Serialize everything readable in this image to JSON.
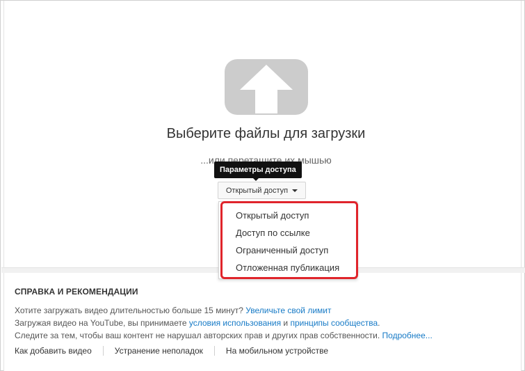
{
  "upload": {
    "title": "Выберите файлы для загрузки",
    "subtitle": "...или перетащите их мышью",
    "icon": "upload-arrow-icon"
  },
  "privacy": {
    "tooltip": "Параметры доступа",
    "button_label": "Открытый доступ",
    "options": [
      "Открытый доступ",
      "Доступ по ссылке",
      "Ограниченный доступ",
      "Отложенная публикация"
    ]
  },
  "help": {
    "title": "СПРАВКА И РЕКОМЕНДАЦИИ",
    "line1_text": "Хотите загружать видео длительностью больше 15 минут? ",
    "line1_link": "Увеличьте свой лимит",
    "line2_text1": "Загружая видео на YouTube, вы принимаете ",
    "line2_link1": "условия использования",
    "line2_text2": " и ",
    "line2_link2": "принципы сообщества",
    "line2_text3": ".",
    "line3_text": "Следите за тем, чтобы ваш контент не нарушал авторских прав и других прав собственности. ",
    "line3_link": "Подробнее...",
    "links": [
      "Как добавить видео",
      "Устранение неполадок",
      "На мобильном устройстве"
    ]
  },
  "colors": {
    "link": "#167ac6",
    "highlight": "#e0242b",
    "icon_gray": "#cccccc"
  }
}
